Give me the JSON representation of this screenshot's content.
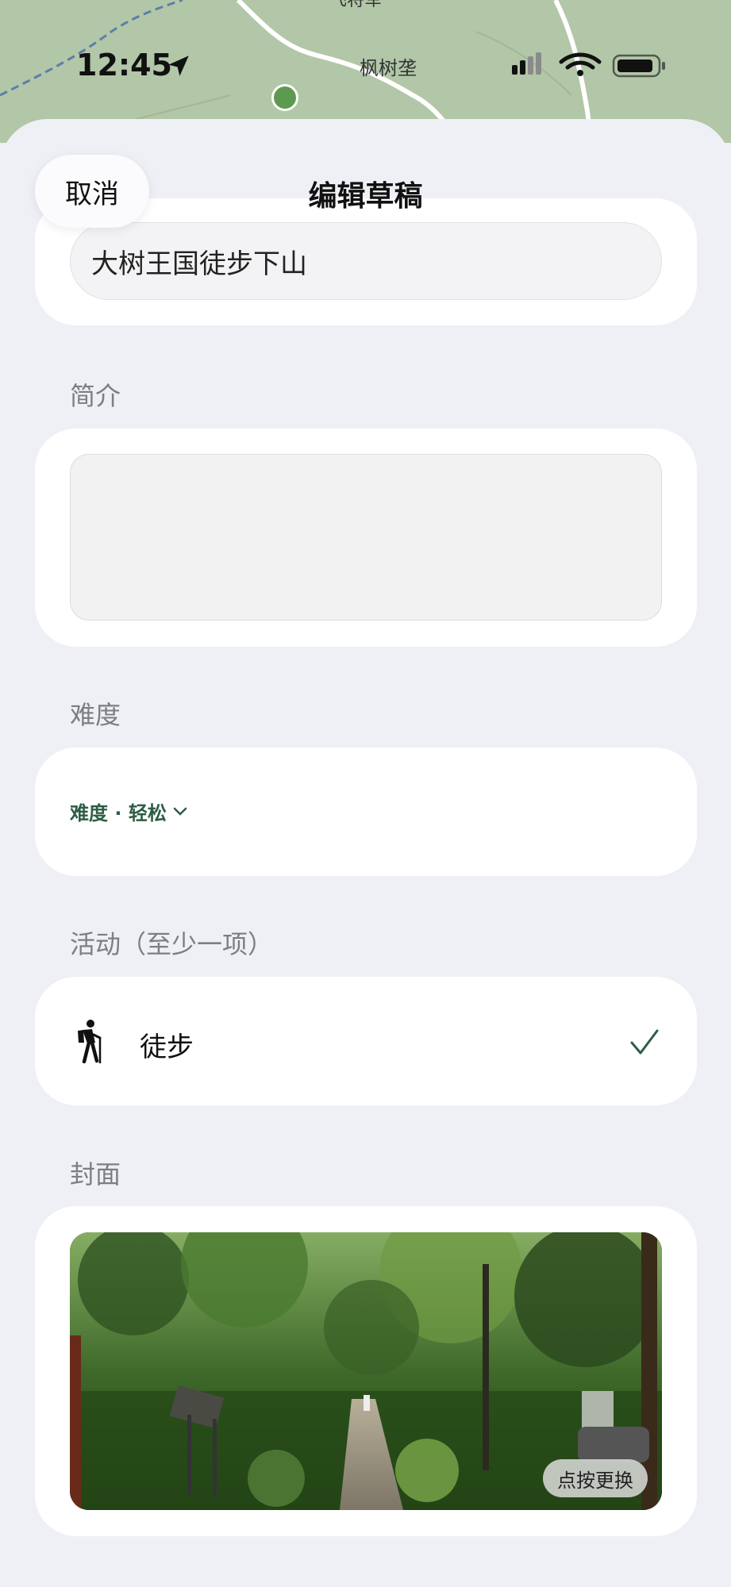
{
  "status_bar": {
    "time": "12:45"
  },
  "map": {
    "place_label": "枫树垄",
    "top_label": "飞将军",
    "pin_icon": "tree-pin-icon"
  },
  "nav": {
    "title": "编辑草稿",
    "cancel_label": "取消"
  },
  "form": {
    "name_value": "大树王国徒步下山",
    "intro_label": "简介",
    "intro_value": "",
    "difficulty_label": "难度",
    "difficulty_value": "难度 · 轻松",
    "activity_label": "活动（至少一项）",
    "activity_item": "徒步",
    "activity_icon": "hiker-icon",
    "activity_selected": true,
    "cover_label": "封面",
    "cover_change_label": "点按更换"
  },
  "colors": {
    "accent": "#2e5e45",
    "background": "#eef0f5"
  }
}
